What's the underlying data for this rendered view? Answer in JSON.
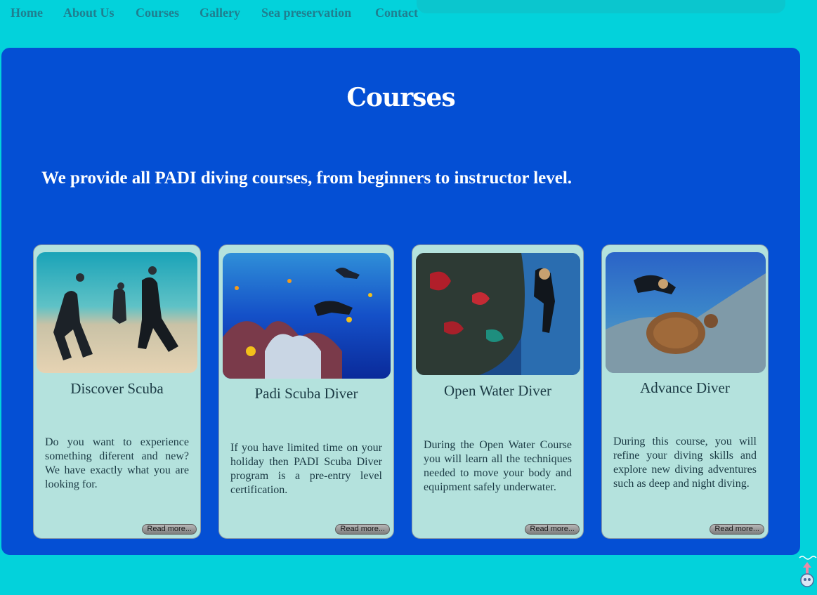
{
  "nav": {
    "items": [
      {
        "label": "Home"
      },
      {
        "label": "About Us"
      },
      {
        "label": "Courses"
      },
      {
        "label": "Gallery"
      },
      {
        "label": "Sea preservation"
      },
      {
        "label": "Contact"
      }
    ]
  },
  "main": {
    "title": "Courses",
    "intro": "We provide all PADI diving courses, from beginners to instructor level."
  },
  "courses": [
    {
      "title": "Discover Scuba",
      "description": "Do you want to experience something diferent and new? We have exactly what you are looking for.",
      "button": "Read more..."
    },
    {
      "title": "Padi Scuba Diver",
      "description": "If you have limited time on your holiday then PADI Scuba Diver program is a pre-entry level certification.",
      "button": "Read more..."
    },
    {
      "title": "Open Water Diver",
      "description": "During the Open Water Course you will learn all the techniques needed to move your body and equipment safely underwater.",
      "button": "Read more..."
    },
    {
      "title": "Advance Diver",
      "description": "During this course, you will refine your diving skills and explore new diving adventures such as deep and night diving.",
      "button": "Read more..."
    }
  ],
  "colors": {
    "page_background": "#03d2db",
    "panel": "#044fd4",
    "card": "#b4e2dd",
    "nav_text": "#1f7f90",
    "card_text": "#1b3a44"
  },
  "icons": {
    "scroll_top": "arrow-up-icon"
  }
}
